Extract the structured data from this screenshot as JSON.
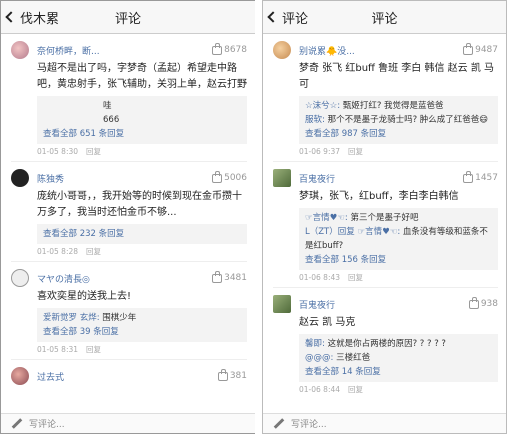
{
  "left": {
    "header": {
      "back_label": "伐木累",
      "title": "评论"
    },
    "comments": [
      {
        "user": "奈何桥畔，断...",
        "likes": "8678",
        "text": "马超不是出了吗，字梦奇（孟起）希望走中路吧，黄忠射手，张飞辅助，关羽上单，赵云打野",
        "replies": [
          {
            "name": "",
            "text": "哇"
          },
          {
            "name": "",
            "text": "666"
          }
        ],
        "more": "查看全部 651 条回复",
        "time": "01-05 8:30",
        "action": "回复"
      },
      {
        "user": "陈独秀",
        "likes": "5006",
        "text": "庞统小哥哥，，我开始等的时候到现在金币攒十万多了，我当时还怕金币不够...",
        "replies": [],
        "more": "查看全部 232 条回复",
        "time": "01-05 8:28",
        "action": "回复"
      },
      {
        "user": "マヤの清長◎",
        "likes": "3481",
        "text": "喜欢奕星的送我上去!",
        "replies": [
          {
            "name": "爱新觉罗 玄烨:",
            "text": "围棋少年"
          }
        ],
        "more": "查看全部 39 条回复",
        "time": "01-05 8:31",
        "action": "回复"
      },
      {
        "user": "过去式",
        "likes": "381",
        "text": "",
        "replies": [],
        "more": "",
        "time": "",
        "action": ""
      }
    ],
    "footer": "写评论..."
  },
  "right": {
    "header": {
      "back_label": "评论",
      "title": "评论"
    },
    "comments": [
      {
        "user": "别说累🐥没...",
        "likes": "9487",
        "text": "梦奇 张飞 红buff 鲁班 李白 韩信 赵云 凯 马可",
        "replies": [
          {
            "name": "☆沫兮☆:",
            "text": "甄姬打红? 我觉得是蓝爸爸"
          },
          {
            "name": "服软:",
            "text": "那个不是墨子龙骑士吗? 肿么成了红爸爸😄"
          }
        ],
        "more": "查看全部 987 条回复",
        "time": "01-06 9:37",
        "action": "回复"
      },
      {
        "user": "百鬼夜行",
        "likes": "1457",
        "text": "梦琪，张飞，红buff，李白李白韩信",
        "replies": [
          {
            "name": "☞言情♥☜:",
            "text": "第三个是墨子好吧"
          },
          {
            "name": "L（ZT）回复 ☞言情♥☜:",
            "text": "血条没有等级和蓝条不是红buff?"
          }
        ],
        "more": "查看全部 156 条回复",
        "time": "01-06 8:43",
        "action": "回复"
      },
      {
        "user": "百鬼夜行",
        "likes": "938",
        "text": "赵云 凯 马克",
        "replies": [
          {
            "name": "馨即:",
            "text": "这就是你占两楼的原因? ? ? ? ?"
          },
          {
            "name": "@@@:",
            "text": "三楼红爸"
          }
        ],
        "more": "查看全部 14 条回复",
        "time": "01-06 8:44",
        "action": "回复"
      }
    ],
    "footer": "写评论..."
  },
  "colors": {
    "link": "#4a6fa5",
    "meta": "#aaaaaa"
  },
  "icons": {
    "back": "chevron-left-icon",
    "like": "thumb-up-icon",
    "compose": "pencil-icon"
  }
}
